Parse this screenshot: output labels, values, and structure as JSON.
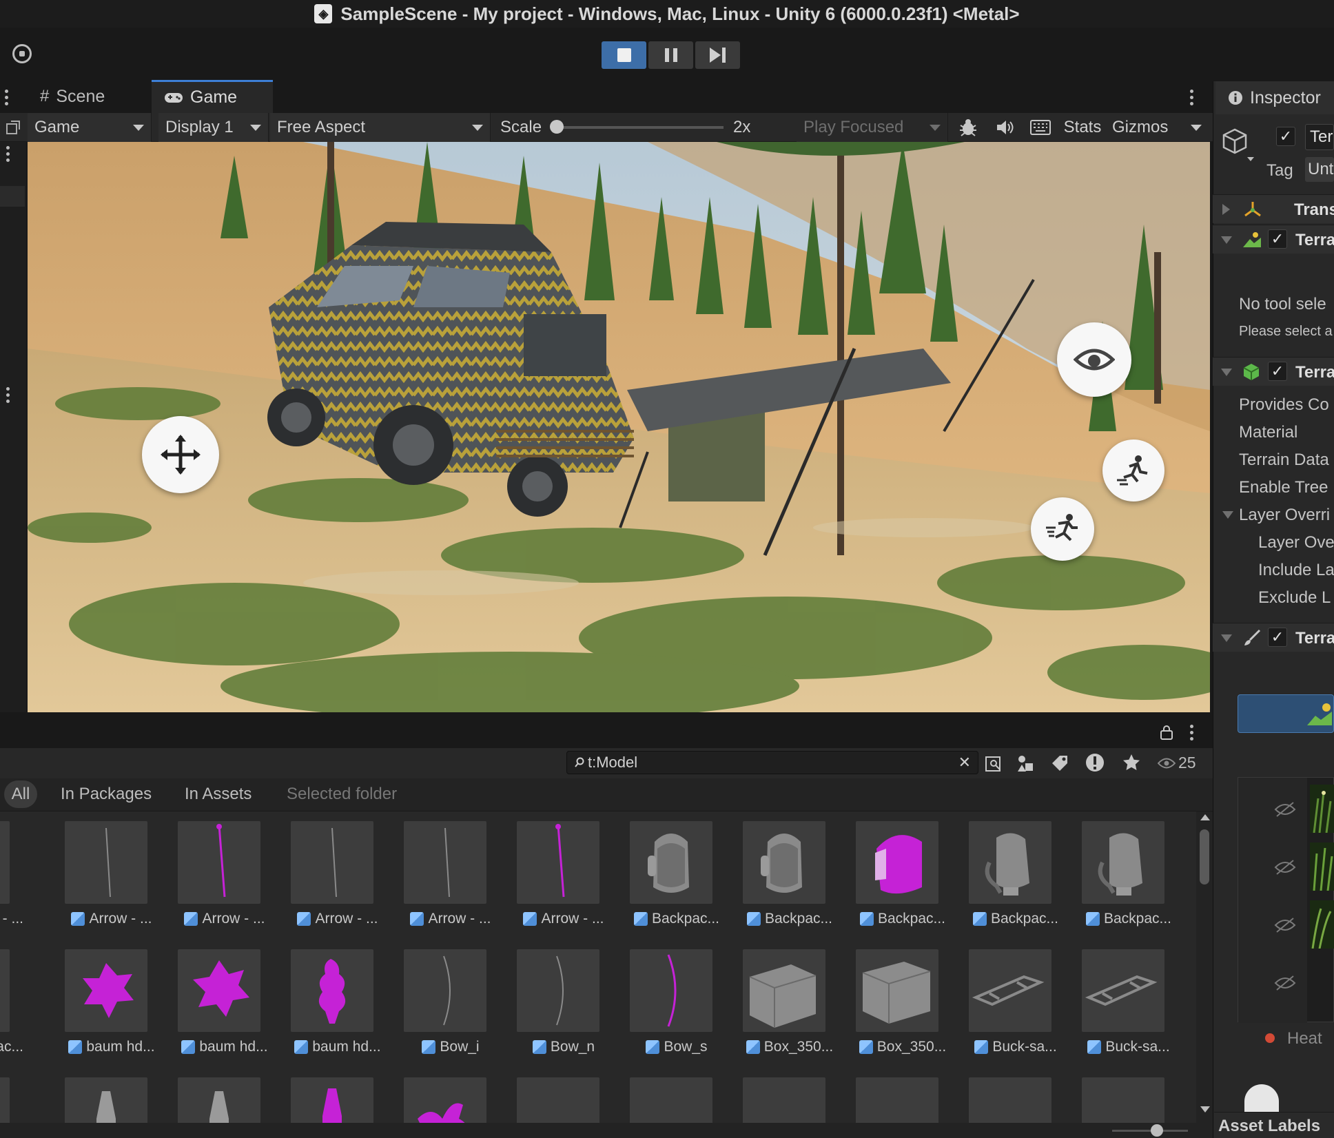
{
  "window": {
    "title": "SampleScene - My project - Windows, Mac, Linux - Unity 6 (6000.0.23f1) <Metal>"
  },
  "tabs": {
    "scene": "Scene",
    "game": "Game"
  },
  "game_toolbar": {
    "view_mode": "Game",
    "display": "Display 1",
    "aspect": "Free Aspect",
    "scale_label": "Scale",
    "scale_value": "2x",
    "play_mode": "Play Focused",
    "stats": "Stats",
    "gizmos": "Gizmos"
  },
  "project": {
    "search_value": "t:Model",
    "hidden_count": "25",
    "filters": [
      "All",
      "In Packages",
      "In Assets",
      "Selected folder"
    ],
    "rows": [
      [
        "w - ...",
        "Arrow - ...",
        "Arrow - ...",
        "Arrow - ...",
        "Arrow - ...",
        "Arrow - ...",
        "Backpac...",
        "Backpac...",
        "Backpac...",
        "Backpac...",
        "Backpac..."
      ],
      [
        "pac...",
        "baum hd...",
        "baum hd...",
        "baum hd...",
        "Bow_i",
        "Bow_n",
        "Bow_s",
        "Box_350...",
        "Box_350...",
        "Buck-sa...",
        "Buck-sa..."
      ]
    ]
  },
  "inspector": {
    "tab": "Inspector",
    "name_partial": "Ter",
    "tag_label": "Tag",
    "tag_value": "Unt",
    "comp_transform": "Trans",
    "comp_terrain": "Terra",
    "no_tool": "No tool sele",
    "please_select": "Please select a",
    "comp_terrain_collider": "Terra",
    "props": [
      "Provides Co",
      "Material",
      "Terrain Data",
      "Enable Tree",
      "Layer Overri",
      "Layer Ove",
      "Include La",
      "Exclude L"
    ],
    "comp_terrain_3": "Terra",
    "heat_label": "Heat",
    "asset_labels": "Asset Labels"
  },
  "colors": {
    "accent": "#3d7fd6",
    "play_active": "#3d6ea8",
    "missing_material": "#c522d6"
  }
}
